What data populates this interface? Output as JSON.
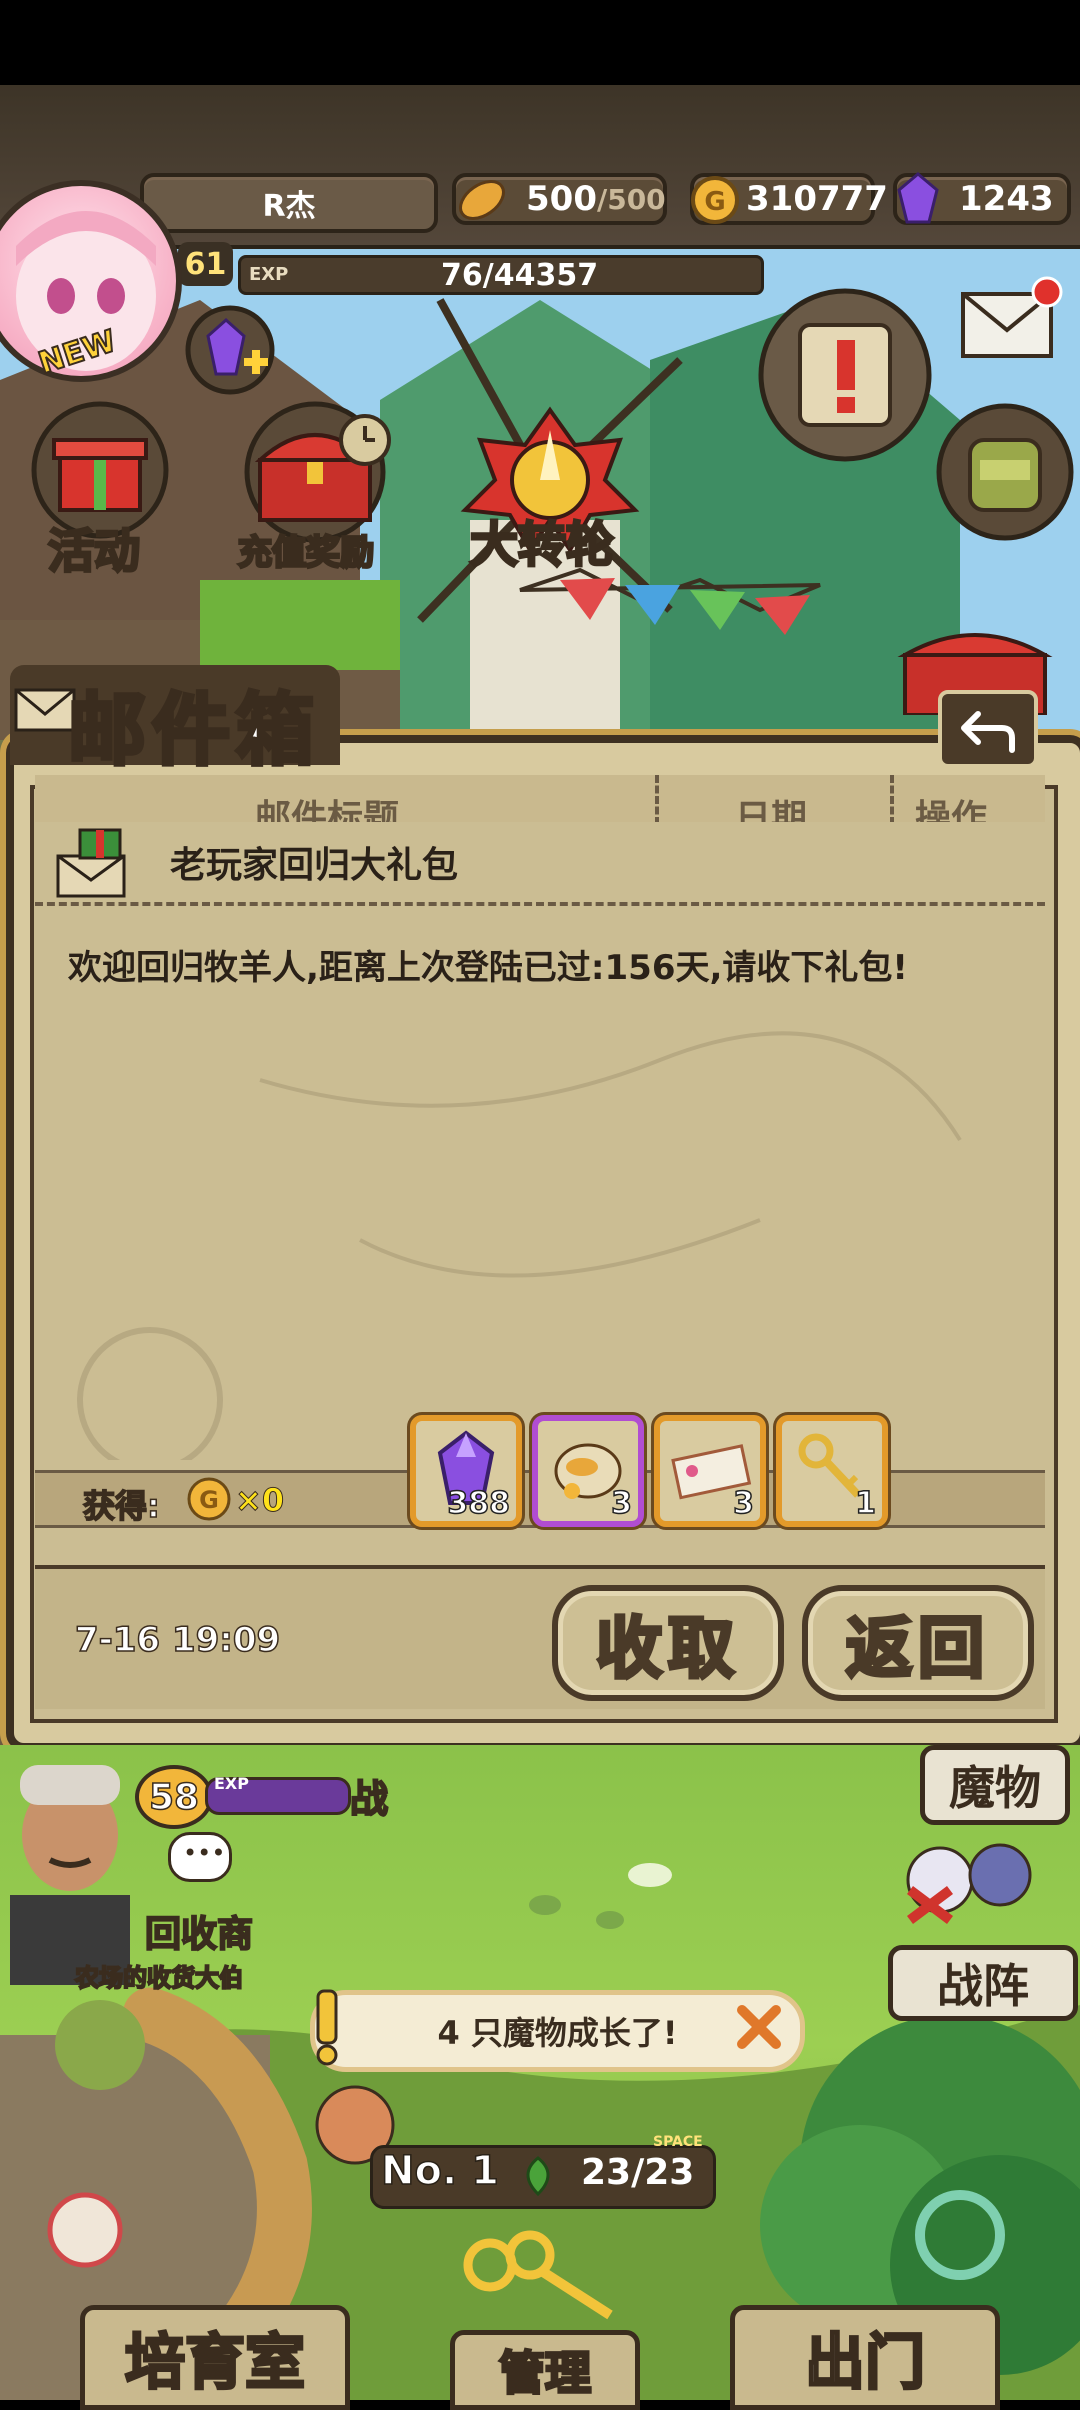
{
  "header": {
    "player_name": "R杰",
    "level": "61",
    "exp_label": "EXP",
    "exp_value": "76/44357",
    "stamina": "500",
    "stamina_max": "/500",
    "gold": "310777",
    "gems": "1243",
    "new_badge": "NEW"
  },
  "menu": {
    "activity": "活动",
    "recharge_reward": "充值奖励",
    "wheel": "大转轮"
  },
  "mailbox": {
    "title": "邮件箱",
    "col_title": "邮件标题",
    "col_date": "日期",
    "col_action": "操作",
    "mail_subject": "老玩家回归大礼包",
    "message": "欢迎回归牧羊人,距离上次登陆已过:156天,请收下礼包!",
    "obtain_label": "获得:",
    "gold_amount": "×0",
    "rewards": [
      {
        "icon": "purple-gem-icon",
        "count": "388"
      },
      {
        "icon": "bread-bag-icon",
        "count": "3"
      },
      {
        "icon": "ticket-icon",
        "count": "3"
      },
      {
        "icon": "golden-key-icon",
        "count": "1"
      }
    ],
    "date": "7-16 19:09",
    "collect_button": "收取",
    "return_button": "返回"
  },
  "lower": {
    "merchant_level": "58",
    "merchant_exp": "EXP",
    "battle": "战",
    "merchant_name": "回收商",
    "merchant_subtitle": "农场的收货大伯",
    "monster": "魔物",
    "formation": "战阵",
    "toast": "4 只魔物成长了!",
    "rank": "No. 1",
    "space_label": "SPACE",
    "space_value": "23/23",
    "nursery": "培育室",
    "manage": "管理",
    "go_out": "出门"
  },
  "colors": {
    "accent_orange": "#e39a2a",
    "panel_bg": "#d8ca9f",
    "dark_brown": "#3d3021",
    "gem_purple": "#8a4fe0",
    "gold": "#f2b63a"
  }
}
